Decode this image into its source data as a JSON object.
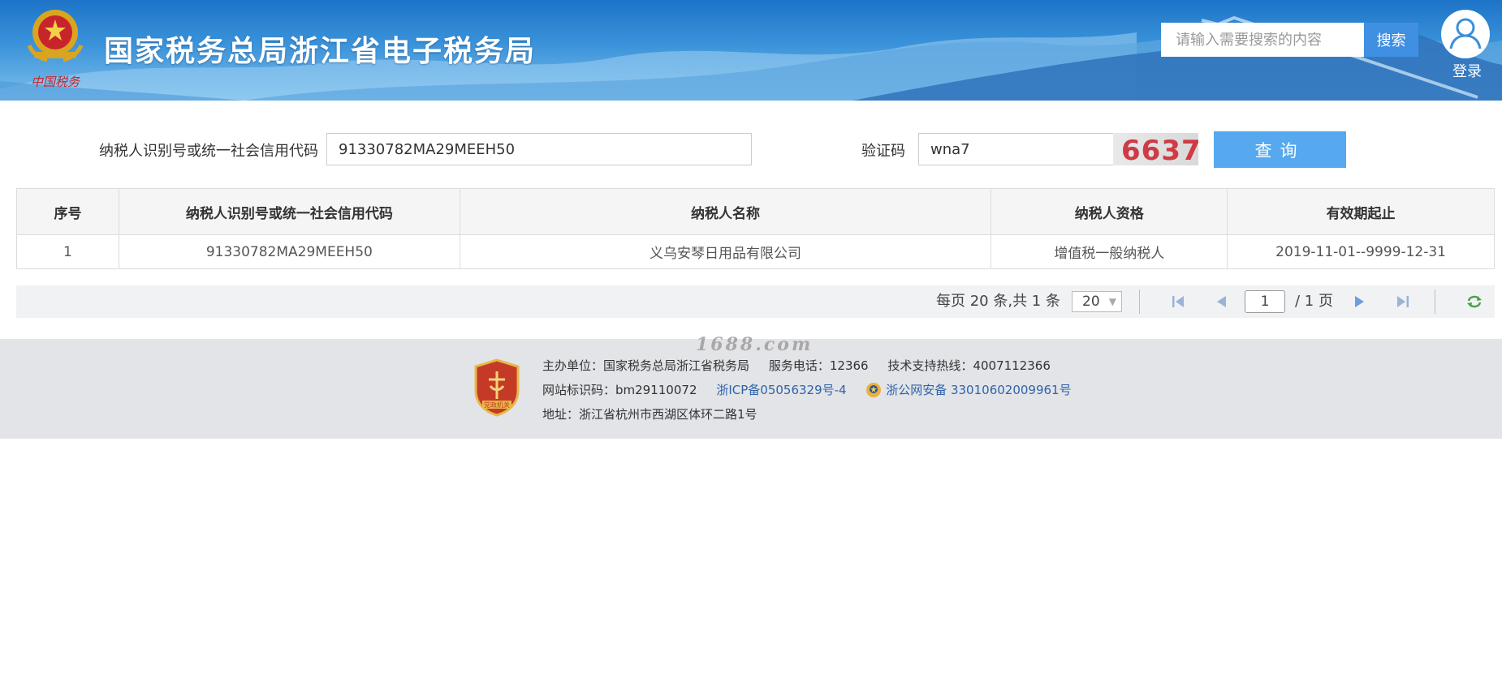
{
  "header": {
    "site_title": "国家税务总局浙江省电子税务局",
    "search_placeholder": "请输入需要搜索的内容",
    "search_button": "搜索",
    "login_label": "登录"
  },
  "form": {
    "id_label": "纳税人识别号或统一社会信用代码",
    "id_value": "91330782MA29MEEH50",
    "captcha_label": "验证码",
    "captcha_value": "wna7",
    "captcha_image_text": "6637",
    "query_button": "查询"
  },
  "table": {
    "headers": [
      "序号",
      "纳税人识别号或统一社会信用代码",
      "纳税人名称",
      "纳税人资格",
      "有效期起止"
    ],
    "rows": [
      [
        "1",
        "91330782MA29MEEH50",
        "义乌安琴日用品有限公司",
        "增值税一般纳税人",
        "2019-11-01--9999-12-31"
      ]
    ]
  },
  "pager": {
    "summary": "每页 20 条,共 1 条",
    "page_size": "20",
    "current_page": "1",
    "total_pages_text": "/ 1 页"
  },
  "footer": {
    "sponsor": "主办单位：国家税务总局浙江省税务局",
    "service_phone": "服务电话：12366",
    "tech_hotline": "技术支持热线：4007112366",
    "site_code": "网站标识码：bm29110072",
    "icp": "浙ICP备05056329号-4",
    "police_record": "浙公网安备 33010602009961号",
    "address": "地址：浙江省杭州市西湖区体环二路1号"
  },
  "watermark": "1688.com",
  "colors": {
    "header_blue": "#2a83d3",
    "search_button": "#3f8fe2",
    "query_button": "#56a9ee",
    "captcha_text": "#cf3a44",
    "link": "#2f63a8"
  }
}
